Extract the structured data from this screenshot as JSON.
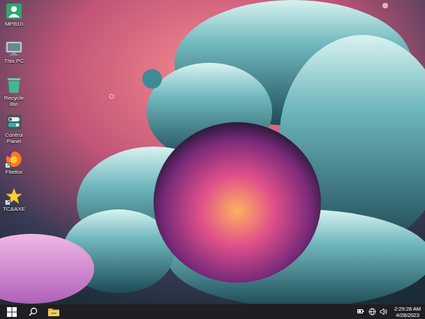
{
  "desktop": {
    "icons": [
      {
        "label": "MPB10",
        "kind": "user",
        "shortcut": false
      },
      {
        "label": "This PC",
        "kind": "pc",
        "shortcut": false
      },
      {
        "label": "Recycle Bin",
        "kind": "recycle",
        "shortcut": false
      },
      {
        "label": "Control Panel",
        "kind": "control",
        "shortcut": false
      },
      {
        "label": "Firefox",
        "kind": "firefox",
        "shortcut": true
      },
      {
        "label": "TC&AXE",
        "kind": "star",
        "shortcut": true
      }
    ]
  },
  "taskbar": {
    "clock": {
      "time": "2:29:26 AM",
      "date": "4/28/2023"
    }
  }
}
